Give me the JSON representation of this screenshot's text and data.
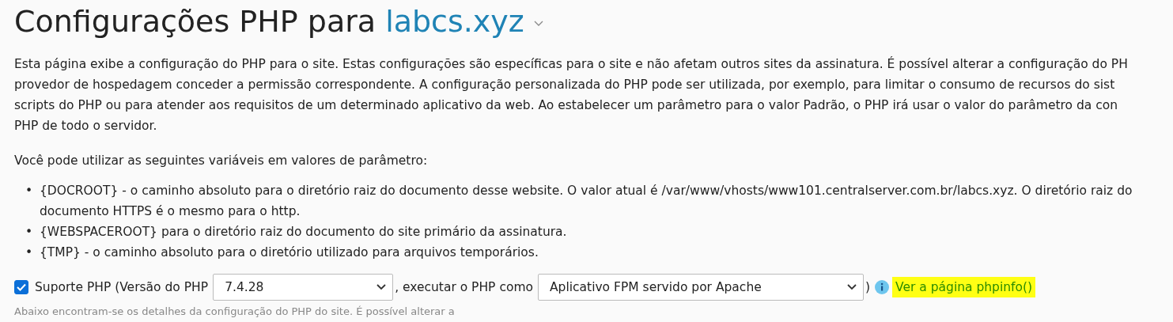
{
  "title": {
    "text": "Configurações PHP para",
    "domain": "labcs.xyz"
  },
  "description": [
    "Esta página exibe a configuração do PHP para o site. Estas configurações são específicas para o site e não afetam outros sites da assinatura. É possível alterar a configuração do PH",
    "provedor de hospedagem conceder a permissão correspondente. A configuração personalizada do PHP pode ser utilizada, por exemplo, para limitar o consumo de recursos do sist",
    "scripts do PHP ou para atender aos requisitos de um determinado aplicativo da web. Ao estabelecer um parâmetro para o valor Padrão, o PHP irá usar o valor do parâmetro da con",
    "PHP de todo o servidor."
  ],
  "variables_intro": "Você pode utilizar as seguintes variáveis em valores de parâmetro:",
  "variables": [
    {
      "bullet": "•",
      "lines": [
        "{DOCROOT} - o caminho absoluto para o diretório raiz do documento desse website. O valor atual é /var/www/vhosts/www101.centralserver.com.br/labcs.xyz. O diretório raiz do",
        "documento HTTPS é o mesmo para o http."
      ]
    },
    {
      "bullet": "•",
      "lines": [
        "{WEBSPACEROOT} para o diretório raiz do documento do site primário da assinatura."
      ]
    },
    {
      "bullet": "•",
      "lines": [
        "{TMP} - o caminho absoluto para o diretório utilizado para arquivos temporários."
      ]
    }
  ],
  "php_support": {
    "checked": true,
    "label": "Suporte PHP (Versão do PHP",
    "version": "7.4.28",
    "run_as_label": ", executar o PHP como",
    "handler": "Aplicativo FPM servido por Apache",
    "close": ")",
    "link": {
      "text": "Ver a página phpinfo()",
      "highlighted": true
    }
  },
  "footnote": "Abaixo encontram-se os detalhes da configuração do PHP do site. É possível alterar a"
}
